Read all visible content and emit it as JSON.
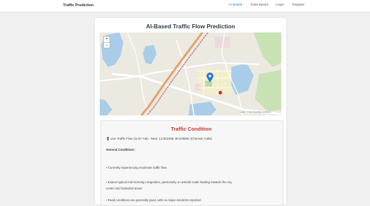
{
  "nav": {
    "brand": "Traffic Prediction",
    "links": [
      "AI Based",
      "Data Based",
      "Login",
      "Register"
    ]
  },
  "page": {
    "title": "AI-Based Traffic Flow Prediction"
  },
  "map": {
    "zoom_in": "+",
    "zoom_out": "−",
    "attribution": "Leaflet | © OpenStreetMap contributors"
  },
  "condition": {
    "title": "Traffic Condition",
    "live": "🚦 Live Traffic Flow (11:07 AM) - Near: 12.821559, 80.045881 (Chennai, India)",
    "general_heading": "General Conditions:",
    "bullets": [
      "• Currently experiencing moderate traffic flow.",
      "• Expect typical mid-morning congestion, particularly on arterial roads leading towards the city",
      "center and industrial areas.",
      "• Road conditions are generally good, with no major incidents reported."
    ]
  },
  "colors": {
    "accent": "#1e6fd9",
    "condition_title": "#c0392b",
    "marker_blue": "#2a73d8",
    "marker_red": "#c0392b"
  }
}
